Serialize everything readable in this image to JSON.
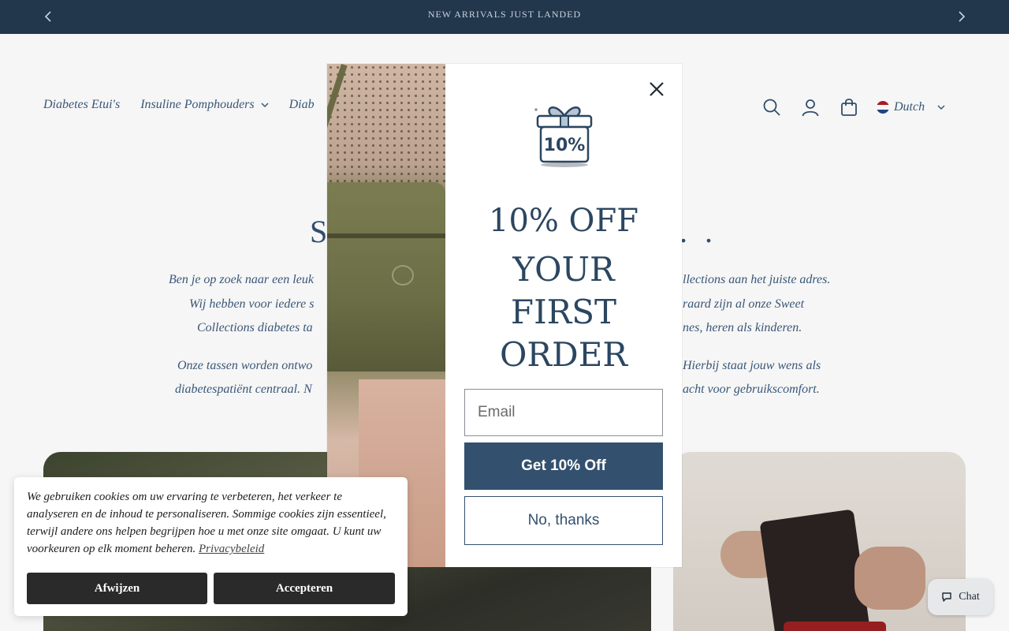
{
  "announcement": {
    "text": "NEW ARRIVALS JUST LANDED",
    "prev_icon": "chevron-left-icon",
    "next_icon": "chevron-right-icon"
  },
  "nav": {
    "items": [
      {
        "label": "Diabetes Etui's",
        "has_dropdown": false
      },
      {
        "label": "Insuline Pomphouders",
        "has_dropdown": true
      },
      {
        "label": "Diab",
        "has_dropdown": false
      }
    ]
  },
  "header": {
    "language": "Dutch",
    "icons": [
      "search-icon",
      "account-icon",
      "cart-icon"
    ]
  },
  "hero": {
    "title_left": "S",
    "title_right": ". .",
    "p1_lines": [
      {
        "left": "Ben je op zoek naar een leuk",
        "right": "llections aan het juiste adres."
      },
      {
        "left": "Wij hebben voor iedere s",
        "right": "raard zijn al onze Sweet"
      },
      {
        "left": "Collections diabetes ta",
        "right": "nes, heren als kinderen."
      }
    ],
    "p2_lines": [
      {
        "left": "Onze tassen worden ontwo",
        "right": "Hierbij staat jouw wens als"
      },
      {
        "left": "diabetespatiënt centraal. N",
        "right": "acht voor gebruikscomfort."
      }
    ]
  },
  "popup": {
    "badge_text": "10%",
    "headline_1": "10% OFF",
    "headline_2": "YOUR",
    "headline_3": "FIRST",
    "headline_4": "ORDER",
    "email_placeholder": "Email",
    "submit_label": "Get 10% Off",
    "decline_label": "No, thanks",
    "colors": {
      "primary": "#33506e",
      "text": "#2b4660"
    }
  },
  "cookie": {
    "text": "We gebruiken cookies om uw ervaring te verbeteren, het verkeer te analyseren en de inhoud te personaliseren. Sommige cookies zijn essentieel, terwijl andere ons helpen begrijpen hoe u met onze site omgaat. U kunt uw voorkeuren op elk moment beheren.",
    "link": "Privacybeleid",
    "reject_label": "Afwijzen",
    "accept_label": "Accepteren"
  },
  "chat": {
    "label": "Chat"
  }
}
